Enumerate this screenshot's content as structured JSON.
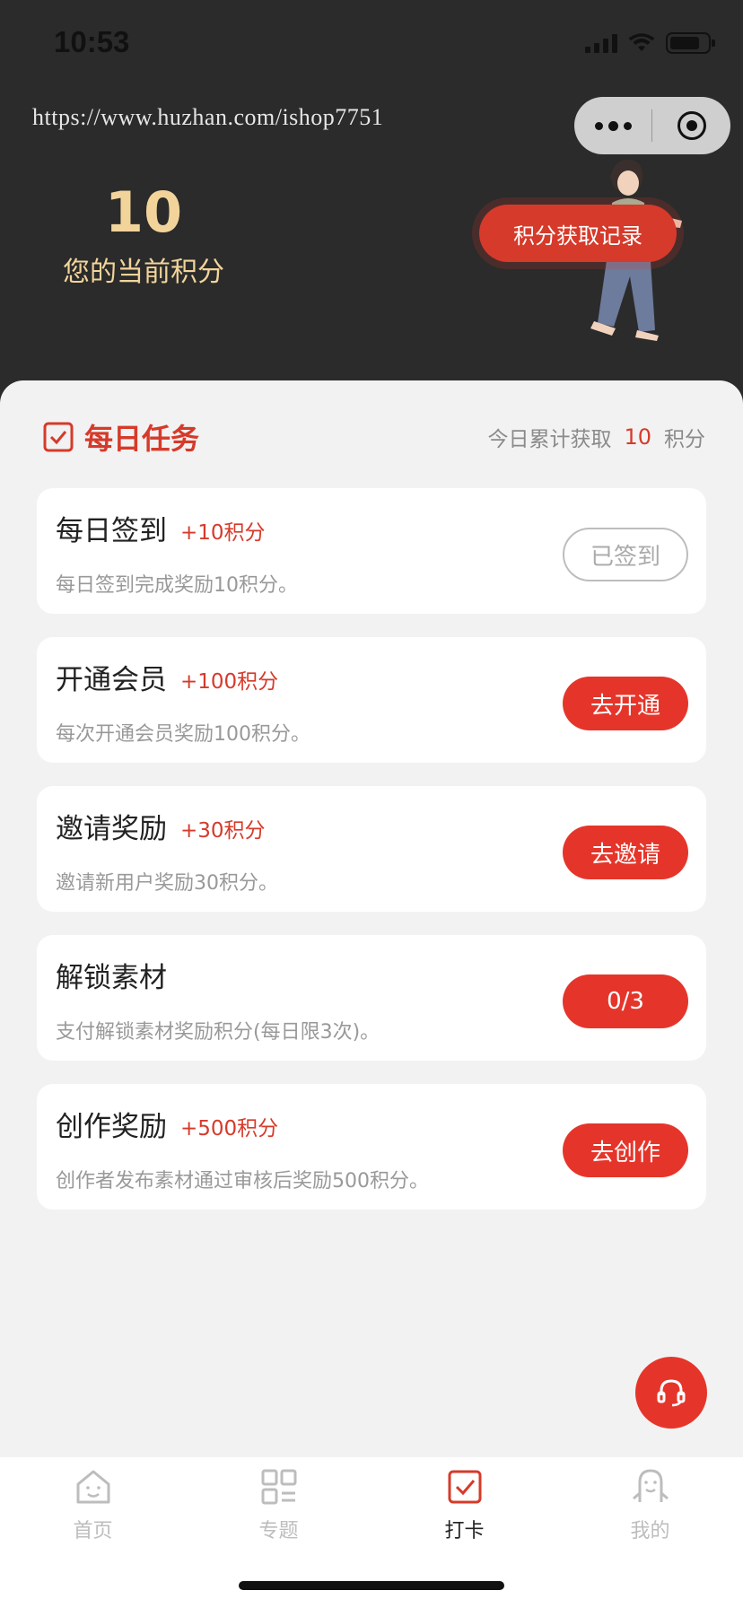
{
  "status_bar": {
    "time": "10:53"
  },
  "header": {
    "url": "https://www.huzhan.com/ishop7751",
    "points_value": "10",
    "points_label": "您的当前积分",
    "record_button": "积分获取记录"
  },
  "section": {
    "title": "每日任务",
    "today_prefix": "今日累计获取",
    "today_value": "10",
    "today_suffix": "积分"
  },
  "tasks": [
    {
      "name": "每日签到",
      "bonus": "+10积分",
      "desc": "每日签到完成奖励10积分。",
      "action": "已签到",
      "done": true
    },
    {
      "name": "开通会员",
      "bonus": "+100积分",
      "desc": "每次开通会员奖励100积分。",
      "action": "去开通",
      "done": false
    },
    {
      "name": "邀请奖励",
      "bonus": "+30积分",
      "desc": "邀请新用户奖励30积分。",
      "action": "去邀请",
      "done": false
    },
    {
      "name": "解锁素材",
      "bonus": "",
      "desc": "支付解锁素材奖励积分(每日限3次)。",
      "action": "0/3",
      "done": false
    },
    {
      "name": "创作奖励",
      "bonus": "+500积分",
      "desc": "创作者发布素材通过审核后奖励500积分。",
      "action": "去创作",
      "done": false
    }
  ],
  "tabs": [
    {
      "label": "首页",
      "icon": "home-icon",
      "active": false
    },
    {
      "label": "专题",
      "icon": "grid-icon",
      "active": false
    },
    {
      "label": "打卡",
      "icon": "checkin-icon",
      "active": true
    },
    {
      "label": "我的",
      "icon": "profile-icon",
      "active": false
    }
  ],
  "colors": {
    "accent": "#e5352a",
    "gold": "#f2d49b",
    "header_bg": "#2b2b2b"
  }
}
